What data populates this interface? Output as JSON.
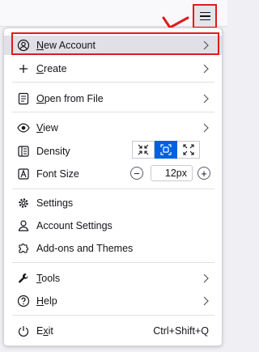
{
  "colors": {
    "annotation": "#e01b1b",
    "accent": "#0061e0",
    "hover": "#e0e0e6"
  },
  "toolbar": {
    "menu_icon": "hamburger-icon"
  },
  "menu": {
    "new_account": {
      "prefix": "",
      "mnemonic": "N",
      "rest": "ew Account",
      "icon": "account-icon"
    },
    "create": {
      "mnemonic": "C",
      "rest": "reate",
      "icon": "plus-icon"
    },
    "open_from_file": {
      "mnemonic": "O",
      "rest": "pen from File",
      "icon": "file-icon"
    },
    "view": {
      "mnemonic": "V",
      "rest": "iew",
      "icon": "eye-icon"
    },
    "density": {
      "label": "Density",
      "icon": "density-icon",
      "options": [
        "compact",
        "normal",
        "touch"
      ],
      "selected": "normal"
    },
    "font_size": {
      "label": "Font Size",
      "icon": "font-size-icon",
      "value": "12px",
      "decrease": "−",
      "increase": "+"
    },
    "settings": {
      "label": "Settings",
      "icon": "gear-icon"
    },
    "account_settings": {
      "label": "Account Settings",
      "icon": "account-settings-icon"
    },
    "addons": {
      "label": "Add-ons and Themes",
      "icon": "puzzle-icon"
    },
    "tools": {
      "mnemonic": "T",
      "rest": "ools",
      "icon": "wrench-icon"
    },
    "help": {
      "mnemonic": "H",
      "rest": "elp",
      "icon": "help-icon"
    },
    "exit": {
      "prefix": "E",
      "mnemonic": "x",
      "rest": "it",
      "shortcut": "Ctrl+Shift+Q",
      "icon": "power-icon"
    }
  }
}
